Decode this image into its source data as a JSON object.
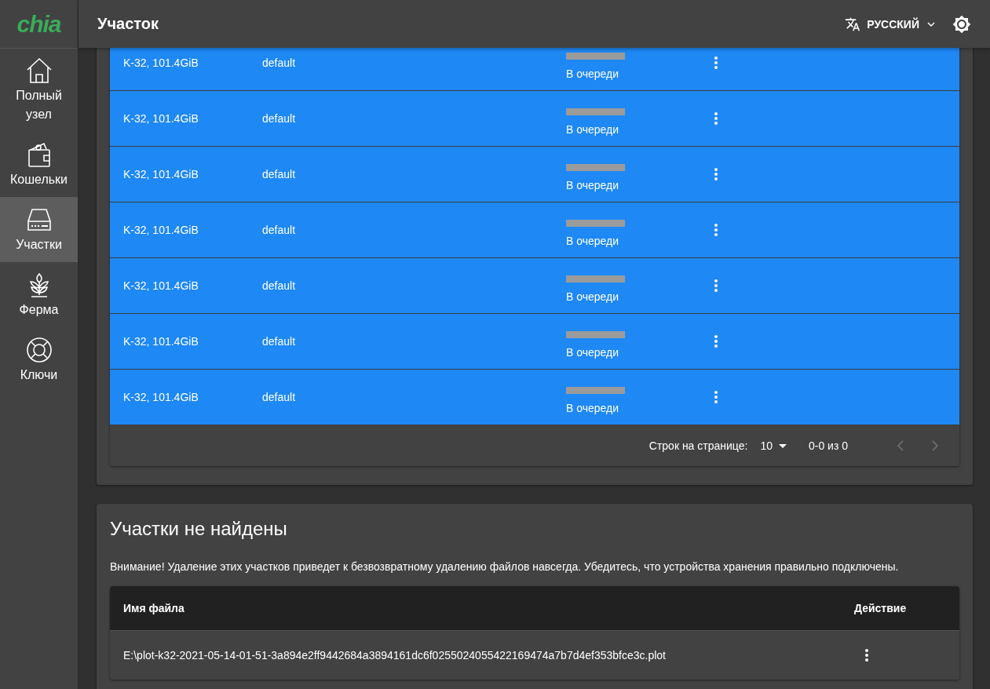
{
  "logo": "chia",
  "sidebar": {
    "items": [
      {
        "label": "Полный узел",
        "selected": false
      },
      {
        "label": "Кошельки",
        "selected": false
      },
      {
        "label": "Участки",
        "selected": true
      },
      {
        "label": "Ферма",
        "selected": false
      },
      {
        "label": "Ключи",
        "selected": false
      }
    ]
  },
  "header": {
    "title": "Участок",
    "language": "РУССКИЙ"
  },
  "queue_table": {
    "rows": [
      {
        "size": "K-32, 101.4GiB",
        "queue": "default",
        "status": "В очереди",
        "level": 0
      },
      {
        "size": "K-32, 101.4GiB",
        "queue": "default",
        "status": "В очереди",
        "level": 0
      },
      {
        "size": "K-32, 101.4GiB",
        "queue": "default",
        "status": "В очереди",
        "level": 0
      },
      {
        "size": "K-32, 101.4GiB",
        "queue": "default",
        "status": "В очереди",
        "level": 0
      },
      {
        "size": "K-32, 101.4GiB",
        "queue": "default",
        "status": "В очереди",
        "level": 0
      },
      {
        "size": "K-32, 101.4GiB",
        "queue": "default",
        "status": "В очереди",
        "level": 0
      },
      {
        "size": "K-32, 101.4GiB",
        "queue": "default",
        "status": "В очереди",
        "level": 0
      }
    ],
    "pagination": {
      "rows_label": "Строк на странице:",
      "rows_per_page": "10",
      "range": "0-0 из 0"
    }
  },
  "not_found": {
    "title": "Участки не найдены",
    "warning": "Внимание! Удаление этих участков приведет к безвозвратному удалению файлов навсегда. Убедитесь, что устройства хранения правильно подключены.",
    "columns": [
      "Имя файла",
      "Действие"
    ],
    "rows": [
      {
        "file": "E:\\plot-k32-2021-05-14-01-51-3a894e2ff9442684a3894161dc6f0255024055422169474a7b7d4ef353bfce3c.plot"
      }
    ]
  }
}
